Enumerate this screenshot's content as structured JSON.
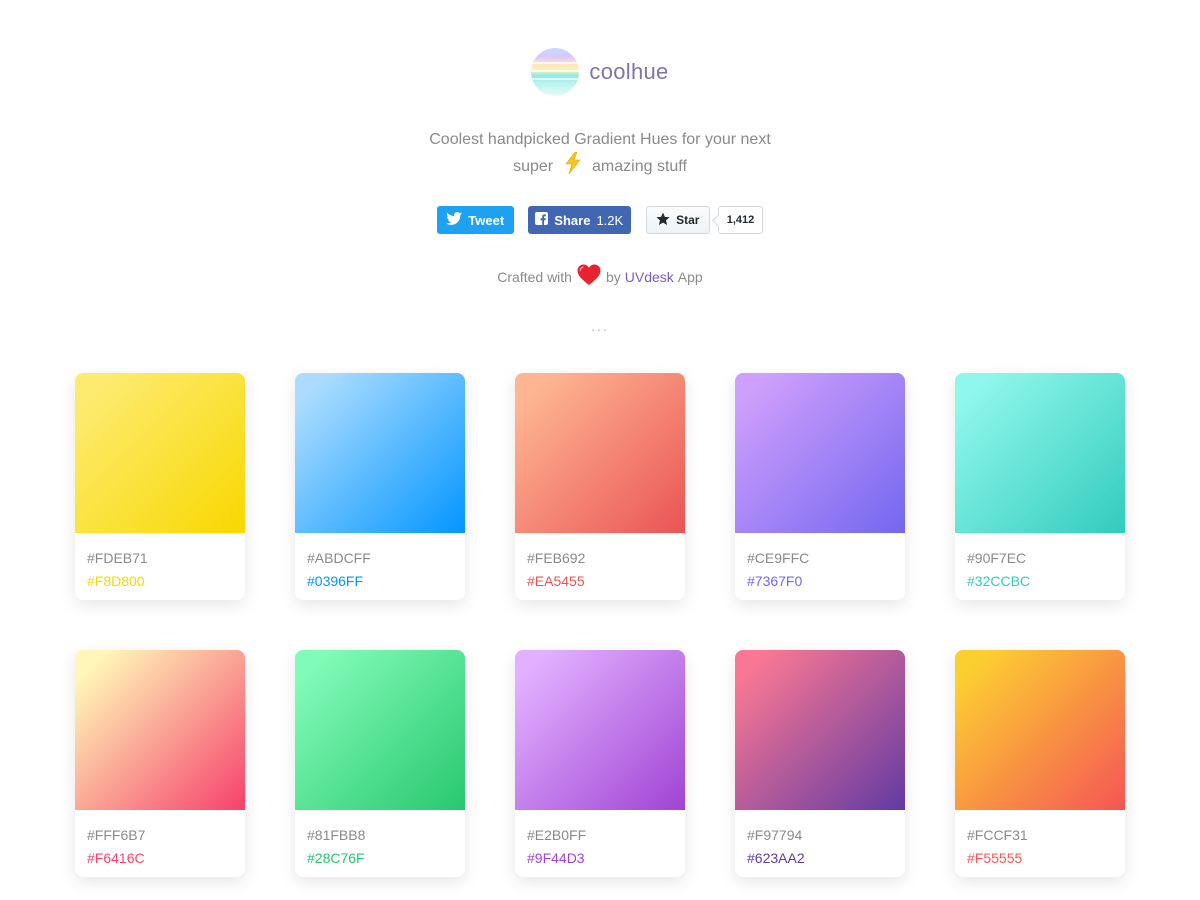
{
  "brand": {
    "name": "coolhue"
  },
  "tagline": {
    "line1": "Coolest handpicked Gradient Hues for your next",
    "line2_before": "super",
    "line2_after": "amazing stuff"
  },
  "social": {
    "tweet_label": "Tweet",
    "share_label": "Share",
    "share_count": "1.2K",
    "star_label": "Star",
    "star_count": "1,412"
  },
  "crafted": {
    "prefix": "Crafted with",
    "by": "by",
    "link": "UVdesk",
    "suffix": "App"
  },
  "dots": "...",
  "colors": {
    "twitter": "#1da1f2",
    "facebook": "#4267b2",
    "link": "#7a5cc7"
  },
  "gradients": [
    {
      "c1": "#FDEB71",
      "c2": "#F8D800"
    },
    {
      "c1": "#ABDCFF",
      "c2": "#0396FF"
    },
    {
      "c1": "#FEB692",
      "c2": "#EA5455"
    },
    {
      "c1": "#CE9FFC",
      "c2": "#7367F0"
    },
    {
      "c1": "#90F7EC",
      "c2": "#32CCBC"
    },
    {
      "c1": "#FFF6B7",
      "c2": "#F6416C"
    },
    {
      "c1": "#81FBB8",
      "c2": "#28C76F"
    },
    {
      "c1": "#E2B0FF",
      "c2": "#9F44D3"
    },
    {
      "c1": "#F97794",
      "c2": "#623AA2"
    },
    {
      "c1": "#FCCF31",
      "c2": "#F55555"
    }
  ]
}
